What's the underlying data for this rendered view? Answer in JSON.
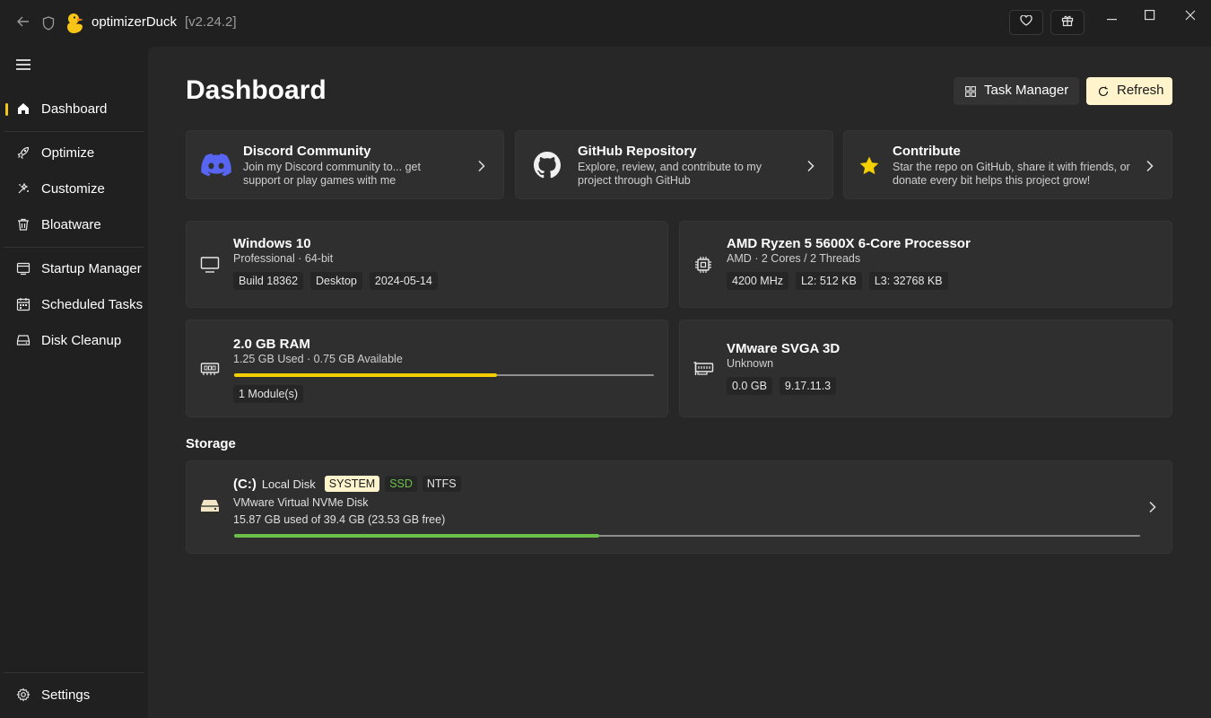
{
  "titlebar": {
    "app_name": "optimizerDuck",
    "version": "[v2.24.2]",
    "back_icon": "back-arrow-icon",
    "shield_icon": "shield-icon",
    "logo_icon": "duck-logo-icon",
    "favorite_icon": "heart-icon",
    "support_icon": "gift-icon",
    "minimize_icon": "minimize-icon",
    "maximize_icon": "maximize-icon",
    "close_icon": "close-icon"
  },
  "sidebar": {
    "menu_icon": "hamburger-icon",
    "items": [
      {
        "label": "Dashboard",
        "icon": "home-icon",
        "active": true
      },
      {
        "label": "Optimize",
        "icon": "rocket-icon",
        "active": false
      },
      {
        "label": "Customize",
        "icon": "paint-icon",
        "active": false
      },
      {
        "label": "Bloatware",
        "icon": "trash-icon",
        "active": false
      },
      {
        "label": "Startup Manager",
        "icon": "startup-icon",
        "active": false
      },
      {
        "label": "Scheduled Tasks",
        "icon": "calendar-icon",
        "active": false
      },
      {
        "label": "Disk Cleanup",
        "icon": "disk-icon",
        "active": false
      }
    ],
    "settings_label": "Settings",
    "settings_icon": "gear-icon"
  },
  "header": {
    "title": "Dashboard",
    "task_manager_label": "Task Manager",
    "refresh_label": "Refresh"
  },
  "links": [
    {
      "title": "Discord Community",
      "desc": "Join my Discord community to... get support or play games with me",
      "icon": "discord-icon"
    },
    {
      "title": "GitHub Repository",
      "desc": "Explore, review, and contribute to my project through GitHub",
      "icon": "github-icon"
    },
    {
      "title": "Contribute",
      "desc": "Star the repo on GitHub, share it with friends, or donate every bit helps this project grow!",
      "icon": "star-icon"
    }
  ],
  "os": {
    "title": "Windows 10",
    "subtitle": "Professional · 64-bit",
    "chips": [
      "Build 18362",
      "Desktop",
      "2024-05-14"
    ],
    "icon": "monitor-icon"
  },
  "cpu": {
    "title": "AMD Ryzen 5 5600X 6-Core Processor",
    "subtitle": "AMD · 2 Cores / 2 Threads",
    "chips": [
      "4200 MHz",
      "L2: 512 KB",
      "L3: 32768 KB"
    ],
    "icon": "cpu-icon"
  },
  "ram": {
    "title": "2.0 GB RAM",
    "subtitle": "1.25 GB Used · 0.75 GB Available",
    "usage_fraction": 0.625,
    "chips": [
      "1 Module(s)"
    ],
    "icon": "ram-icon",
    "bar_color": "#f5d000"
  },
  "gpu": {
    "title": "VMware SVGA 3D",
    "subtitle": "Unknown",
    "chips": [
      "0.0 GB",
      "9.17.11.3"
    ],
    "icon": "gpu-icon"
  },
  "storage": {
    "section_title": "Storage",
    "drive_letter": "(C:)",
    "drive_name": "Local Disk",
    "badges": {
      "system": "SYSTEM",
      "type": "SSD",
      "fs": "NTFS"
    },
    "model": "VMware Virtual NVMe Disk",
    "usage": "15.87 GB used of 39.4 GB (23.53 GB free)",
    "usage_fraction": 0.403,
    "bar_color": "#6cc04a",
    "icon": "drive-icon"
  },
  "colors": {
    "accent": "#f5c518",
    "refresh_bg": "#fff4cc",
    "ssd_text": "#6cc04a",
    "discord": "#5865f2",
    "star": "#f5d000"
  }
}
